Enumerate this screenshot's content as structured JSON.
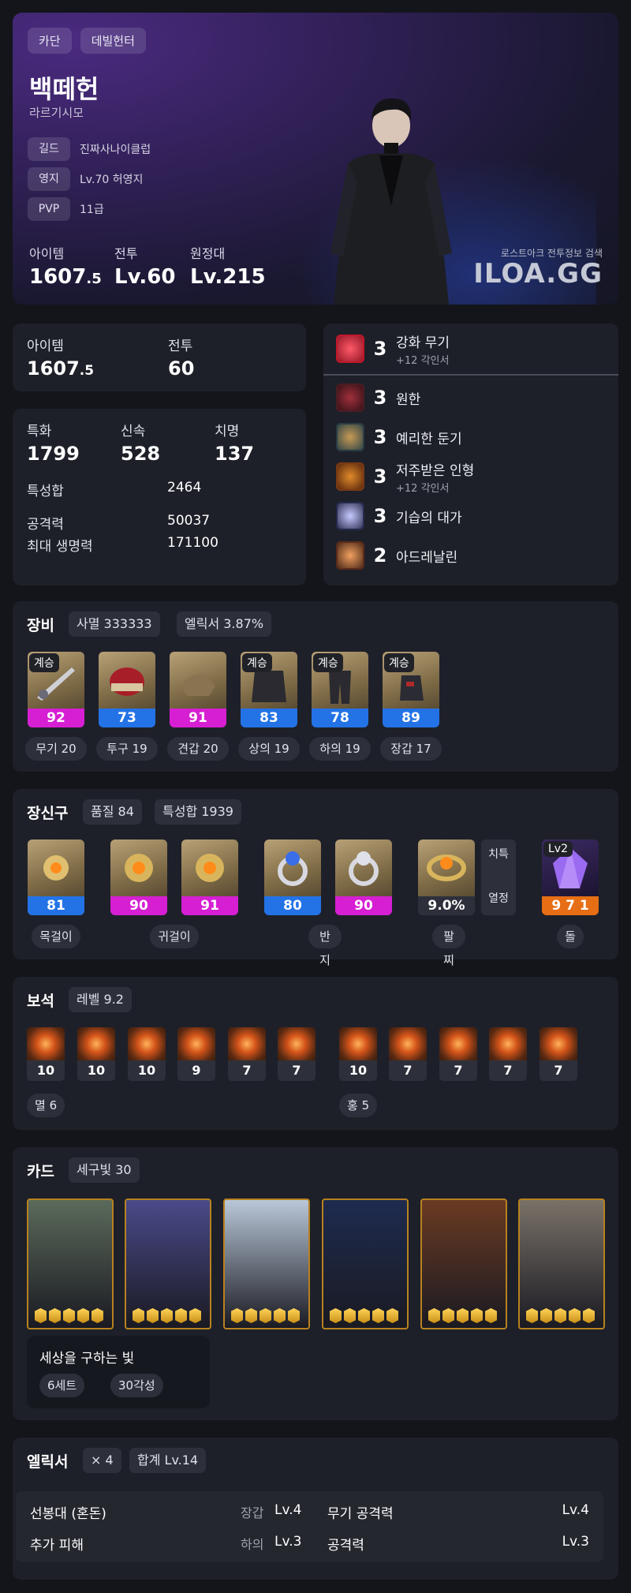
{
  "profile": {
    "tags": [
      "카단",
      "데빌헌터"
    ],
    "name": "백떼헌",
    "server": "라르기시모",
    "info": [
      {
        "key": "길드",
        "value": "진짜사나이클럽"
      },
      {
        "key": "영지",
        "value": "Lv.70 허영지"
      },
      {
        "key": "PVP",
        "value": "11급"
      }
    ],
    "stats": [
      {
        "label": "아이템",
        "value": "1607",
        "decimal": ".5"
      },
      {
        "label": "전투",
        "value": "Lv.60",
        "decimal": ""
      },
      {
        "label": "원정대",
        "value": "Lv.215",
        "decimal": ""
      }
    ],
    "watermark_small": "로스트아크 전투정보 검색",
    "watermark_big": "ILOA.GG"
  },
  "summary": {
    "item_label": "아이템",
    "item_value": "1607",
    "item_decimal": ".5",
    "combat_label": "전투",
    "combat_value": "60"
  },
  "stats": {
    "specs": [
      {
        "label": "특화",
        "value": "1799"
      },
      {
        "label": "신속",
        "value": "528"
      },
      {
        "label": "치명",
        "value": "137"
      }
    ],
    "rows": [
      {
        "label": "특성합",
        "value": "2464"
      },
      {
        "label": "공격력",
        "value": "50037"
      },
      {
        "label": "최대 생명력",
        "value": "171100"
      }
    ]
  },
  "engravings": [
    {
      "level": "3",
      "name": "강화 무기",
      "sub": "+12 각인서",
      "color": "#c0182a"
    },
    {
      "level": "3",
      "name": "원한",
      "sub": "",
      "color": "#4b1d24"
    },
    {
      "level": "3",
      "name": "예리한 둔기",
      "sub": "",
      "color": "#2a3c44"
    },
    {
      "level": "3",
      "name": "저주받은 인형",
      "sub": "+12 각인서",
      "color": "#7a3a14"
    },
    {
      "level": "3",
      "name": "기습의 대가",
      "sub": "",
      "color": "#252a4d"
    },
    {
      "level": "2",
      "name": "아드레날린",
      "sub": "",
      "color": "#5a2c1a"
    }
  ],
  "equipment": {
    "title": "장비",
    "chips": [
      "사멸 333333",
      "엘릭서 3.87%"
    ],
    "items": [
      {
        "badge": "계승",
        "quality": "92",
        "tier": "pink",
        "label": "무기 20",
        "icon": "weapon-icon"
      },
      {
        "badge": "",
        "quality": "73",
        "tier": "blue",
        "label": "투구 19",
        "icon": "helmet-icon"
      },
      {
        "badge": "",
        "quality": "91",
        "tier": "pink",
        "label": "견갑 20",
        "icon": "shoulder-icon"
      },
      {
        "badge": "계승",
        "quality": "83",
        "tier": "blue",
        "label": "상의 19",
        "icon": "chest-icon"
      },
      {
        "badge": "계승",
        "quality": "78",
        "tier": "blue",
        "label": "하의 19",
        "icon": "pants-icon"
      },
      {
        "badge": "계승",
        "quality": "89",
        "tier": "blue",
        "label": "장갑 17",
        "icon": "gloves-icon"
      }
    ]
  },
  "accessories": {
    "title": "장신구",
    "chips": [
      "품질 84",
      "특성합 1939"
    ],
    "items": [
      {
        "quality": "81",
        "tier": "blue",
        "icon": "necklace-icon"
      },
      {
        "quality": "90",
        "tier": "pink",
        "icon": "earring-icon"
      },
      {
        "quality": "91",
        "tier": "pink",
        "icon": "earring-icon"
      },
      {
        "quality": "80",
        "tier": "blue",
        "icon": "ring-icon"
      },
      {
        "quality": "90",
        "tier": "pink",
        "icon": "ring-icon"
      }
    ],
    "bracelet": {
      "value": "9.0%",
      "stats": [
        "치특",
        "열정"
      ]
    },
    "stone": {
      "badge": "Lv2",
      "value": "9 7 1"
    },
    "labels": [
      "목걸이",
      "귀걸이",
      "반지",
      "팔찌",
      "돌"
    ]
  },
  "gems": {
    "title": "보석",
    "chips": [
      "레벨 9.2"
    ],
    "left": [
      "10",
      "10",
      "10",
      "9",
      "7",
      "7"
    ],
    "right": [
      "10",
      "7",
      "7",
      "7",
      "7"
    ],
    "left_label": "멸 6",
    "right_label": "홍 5"
  },
  "cards": {
    "title": "카드",
    "chips": [
      "세구빛 30"
    ],
    "set_name": "세상을 구하는 빛",
    "set_tags": [
      "6세트",
      "30각성"
    ],
    "colors": [
      "#5b6a5a",
      "#4a4a8a",
      "#b9c7d8",
      "#1e2b4f",
      "#6a3a22",
      "#7a7268"
    ]
  },
  "elixir": {
    "title": "엘릭서",
    "chips": [
      "× 4",
      "합계 Lv.14"
    ],
    "rows": [
      {
        "left_name": "선봉대 (혼돈)",
        "left_slot": "장갑",
        "left_lv": "Lv.4",
        "right_name": "무기 공격력",
        "right_lv": "Lv.4"
      },
      {
        "left_name": "추가 피해",
        "left_slot": "하의",
        "left_lv": "Lv.3",
        "right_name": "공격력",
        "right_lv": "Lv.3"
      }
    ]
  }
}
